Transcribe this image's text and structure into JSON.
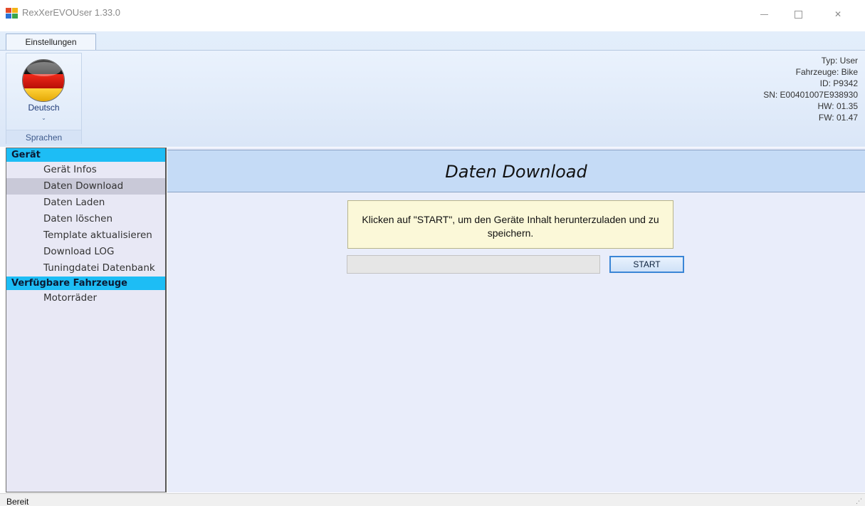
{
  "window": {
    "title": "RexXerEVOUser 1.33.0",
    "controls": {
      "minimize_icon": "minimize-icon",
      "maximize_icon": "maximize-icon",
      "close_glyph": "✕"
    }
  },
  "ribbon": {
    "tab_label": "Einstellungen",
    "language": {
      "label": "Deutsch",
      "caret": "⌄",
      "flag_icon": "germany-flag-icon"
    },
    "group_label": "Sprachen"
  },
  "device_info": {
    "typ": "Typ: User",
    "fahrzeuge": "Fahrzeuge: Bike",
    "id": "ID: P9342",
    "sn": "SN: E00401007E938930",
    "hw": "HW: 01.35",
    "fw": "FW: 01.47"
  },
  "nav": {
    "sections": [
      {
        "header": "Gerät",
        "items": [
          "Gerät Infos",
          "Daten Download",
          "Daten Laden",
          "Daten löschen",
          "Template aktualisieren",
          "Download LOG",
          "Tuningdatei Datenbank"
        ]
      },
      {
        "header": "Verfügbare Fahrzeuge",
        "items": [
          "Motorräder"
        ]
      }
    ],
    "selected": "Daten Download"
  },
  "content": {
    "title": "Daten Download",
    "info_text": "Klicken auf \"START\", um den Geräte Inhalt herunterzuladen und zu speichern.",
    "progress_value": 0,
    "start_button": "START"
  },
  "status": {
    "text": "Bereit"
  },
  "colors": {
    "nav_header": "#1dbdf5",
    "banner": "#c5dbf6",
    "info_box": "#fbf8d8",
    "selected_item": "#c9c9d8"
  }
}
